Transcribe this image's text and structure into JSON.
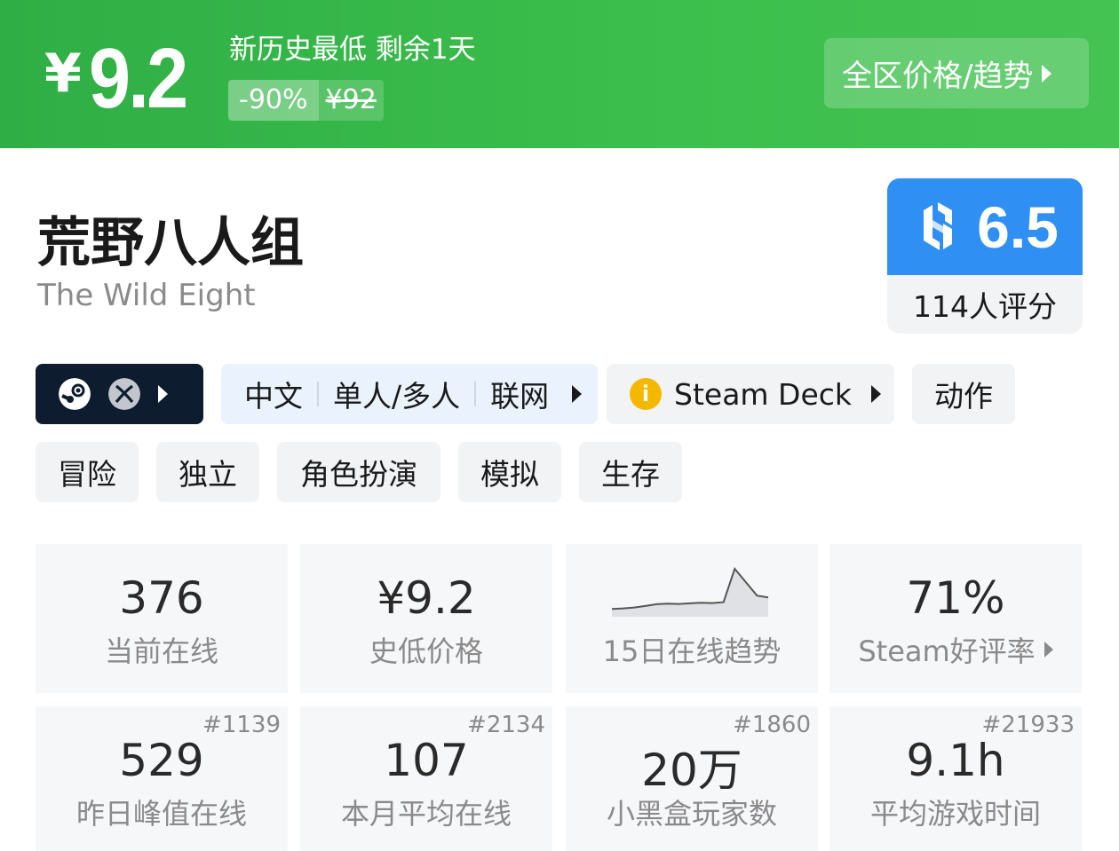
{
  "banner": {
    "currency": "¥",
    "price": "9.2",
    "status": "新历史最低 剩余1天",
    "discount": "-90%",
    "original_price": "¥92",
    "trend_button": "全区价格/趋势"
  },
  "game": {
    "title_cn": "荒野八人组",
    "title_en": "The Wild Eight"
  },
  "score": {
    "value": "6.5",
    "raters": "114人评分"
  },
  "platforms": {
    "icons": [
      "steam-icon",
      "xbox-icon"
    ]
  },
  "features": [
    "中文",
    "单人/多人",
    "联网"
  ],
  "steam_deck": {
    "label": "Steam Deck",
    "icon": "info-icon"
  },
  "tags": [
    "动作",
    "冒险",
    "独立",
    "角色扮演",
    "模拟",
    "生存"
  ],
  "stats": [
    {
      "value": "376",
      "label": "当前在线"
    },
    {
      "value": "¥9.2",
      "label": "史低价格"
    },
    {
      "label": "15日在线趋势"
    },
    {
      "value": "71%",
      "label": "Steam好评率"
    },
    {
      "value": "529",
      "label": "昨日峰值在线",
      "rank": "#1139"
    },
    {
      "value": "107",
      "label": "本月平均在线",
      "rank": "#2134"
    },
    {
      "value": "20万",
      "label": "小黑盒玩家数",
      "rank": "#1860"
    },
    {
      "value": "9.1h",
      "label": "平均游戏时间",
      "rank": "#21933"
    }
  ],
  "colors": {
    "banner_green": "#3cbf4c",
    "score_blue": "#2f8ff2",
    "platform_dark": "#0e1c2f",
    "deck_warning": "#f5b800"
  },
  "sparkline": {
    "values": [
      2,
      2.2,
      2.5,
      3,
      3.6,
      3.8,
      3.7,
      3.9,
      4.1,
      4.0,
      4.3,
      15.5,
      11,
      6.5,
      5.9
    ]
  }
}
